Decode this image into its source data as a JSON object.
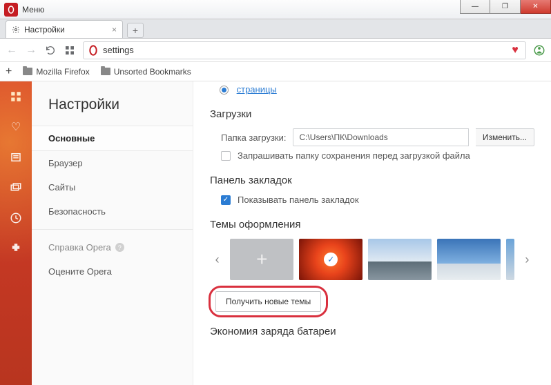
{
  "window": {
    "menu_label": "Меню"
  },
  "tab": {
    "title": "Настройки"
  },
  "address": {
    "value": "settings"
  },
  "bookmarks_bar": {
    "items": [
      "Mozilla Firefox",
      "Unsorted Bookmarks"
    ]
  },
  "settings": {
    "heading": "Настройки",
    "nav": {
      "basic": "Основные",
      "browser": "Браузер",
      "sites": "Сайты",
      "security": "Безопасность",
      "help": "Справка Opera",
      "rate": "Оцените Opera"
    }
  },
  "content": {
    "startup_truncated_link": "страницы",
    "downloads": {
      "title": "Загрузки",
      "folder_label": "Папка загрузки:",
      "folder_path": "C:\\Users\\ПК\\Downloads",
      "change_btn": "Изменить...",
      "ask_checkbox": "Запрашивать папку сохранения перед загрузкой файла"
    },
    "bookmarks_panel": {
      "title": "Панель закладок",
      "show_checkbox": "Показывать панель закладок"
    },
    "themes": {
      "title": "Темы оформления",
      "get_more_btn": "Получить новые темы"
    },
    "battery": {
      "title": "Экономия заряда батареи"
    }
  }
}
